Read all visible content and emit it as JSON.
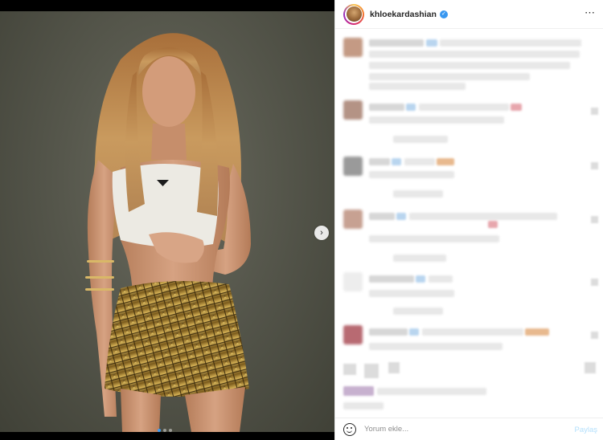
{
  "post": {
    "username": "khloekardashian",
    "verified": true,
    "more_icon": "more-horizontal-icon",
    "carousel": {
      "total": 3,
      "current": 1
    },
    "photo_alt": "Woman with long blonde hair, white crop top and gold sequin mini skirt"
  },
  "comment_box": {
    "placeholder": "Yorum ekle...",
    "post_label": "Paylaş"
  },
  "colors": {
    "accent": "#3897f0",
    "post_disabled": "#b2dffc",
    "text": "#262626",
    "muted": "#8e8e8e"
  }
}
